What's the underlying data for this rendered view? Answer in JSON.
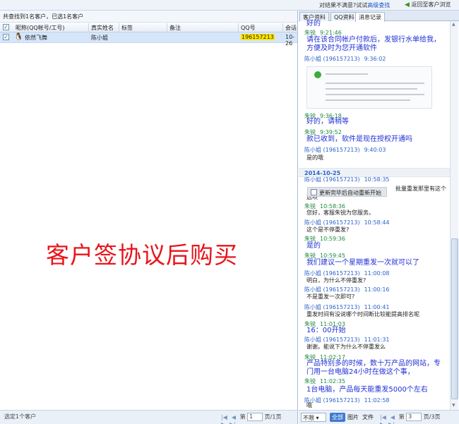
{
  "topbar": {
    "feedback_prefix": "对结果不满意?试试",
    "feedback_link": "高级查找",
    "back_label": "返回至客户浏览"
  },
  "left": {
    "summary": "共查找到1名客户，已选1名客户",
    "columns": [
      "昵称(QQ帐号/工号)",
      "真实姓名",
      "标签",
      "备注",
      "QQ号",
      "会话"
    ],
    "rows": [
      {
        "nickname": "依然飞舞",
        "real_name": "陈小姐",
        "tag": "",
        "note": "",
        "qq": "196157213",
        "session": "10-26"
      }
    ],
    "watermark": "客户签协议后购买",
    "footer": {
      "status": "选定1个客户",
      "page_prefix": "第",
      "page_value": "1",
      "page_suffix": "页/1页"
    }
  },
  "right": {
    "tabs": [
      "客户资料",
      "QQ资料",
      "消息记录"
    ],
    "messages": [
      {
        "type": "text-big",
        "text": "好的"
      },
      {
        "type": "hdr-g",
        "name": "朱锐",
        "time": "9:21:46"
      },
      {
        "type": "text-big",
        "text": "请在该合同帐户付款后，发银行水单给我，"
      },
      {
        "type": "text-big",
        "text": "方便及时为您开通软件"
      },
      {
        "type": "hdr-b",
        "name": "陈小姐 (196157213)",
        "time": "9:36:02"
      },
      {
        "type": "hdr-g",
        "name": "朱锐",
        "time": "9:36:18"
      },
      {
        "type": "text-big",
        "text": "好的，请稍等"
      },
      {
        "type": "hdr-g",
        "name": "朱锐",
        "time": "9:39:52"
      },
      {
        "type": "text-big",
        "text": "款已收到，软件是现在授权开通吗"
      },
      {
        "type": "hdr-b",
        "name": "陈小姐 (196157213)",
        "time": "9:40:03"
      },
      {
        "type": "text-small",
        "text": "是的哦"
      },
      {
        "type": "hdr-b",
        "name": "陈小姐 (196157213)",
        "time": "10:58:35"
      },
      {
        "type": "text-small",
        "text": "批量重发那里有这个"
      },
      {
        "type": "text-small",
        "text": "选项"
      },
      {
        "type": "hdr-g",
        "name": "朱锐",
        "time": "10:58:36"
      },
      {
        "type": "text-small",
        "text": "您好，客服朱锐为您服务。"
      },
      {
        "type": "hdr-b",
        "name": "陈小姐 (196157213)",
        "time": "10:58:44"
      },
      {
        "type": "text-small",
        "text": "这个是不停重发?"
      },
      {
        "type": "hdr-g",
        "name": "朱锐",
        "time": "10:59:36"
      },
      {
        "type": "text-big",
        "text": "是的"
      },
      {
        "type": "hdr-g",
        "name": "朱锐",
        "time": "10:59:45"
      },
      {
        "type": "text-big",
        "text": "我们建议一个星期重发一次就可以了"
      },
      {
        "type": "hdr-b",
        "name": "陈小姐 (196157213)",
        "time": "11:00:08"
      },
      {
        "type": "text-small",
        "text": "明白，为什么不停重发?"
      },
      {
        "type": "hdr-b",
        "name": "陈小姐 (196157213)",
        "time": "11:00:16"
      },
      {
        "type": "text-small",
        "text": "不是重发一次即可?"
      },
      {
        "type": "hdr-b",
        "name": "陈小姐 (196157213)",
        "time": "11:00:41"
      },
      {
        "type": "text-small",
        "text": "重发时间有没说哪个时间断比较能提高排名呢"
      },
      {
        "type": "hdr-g",
        "name": "朱锐",
        "time": "11:01:03"
      },
      {
        "type": "text-big",
        "text": "16：00开始"
      },
      {
        "type": "hdr-b",
        "name": "陈小姐 (196157213)",
        "time": "11:01:31"
      },
      {
        "type": "text-small",
        "text": "谢谢。能说下为什么不停重发么"
      },
      {
        "type": "hdr-g",
        "name": "朱锐",
        "time": "11:02:17"
      },
      {
        "type": "text-big",
        "text": "产品特别多的时候，数十万产品的网站，专"
      },
      {
        "type": "text-big",
        "text": "门用一台电脑24小时在做这个事，"
      },
      {
        "type": "hdr-g",
        "name": "朱锐",
        "time": "11:02:35"
      },
      {
        "type": "text-big",
        "text": "1台电脑，产品每天能重发5000个左右"
      },
      {
        "type": "hdr-b",
        "name": "陈小姐 (196157213)",
        "time": "11:02:58"
      },
      {
        "type": "text-small",
        "text": "哦"
      }
    ],
    "date_divider": "2014-10-25",
    "checkbox_label": "更新完毕后自动重新开始",
    "footer": {
      "dropdown": "不限",
      "tabs": [
        "全部",
        "图片",
        "文件"
      ],
      "page_prefix": "第",
      "page_value": "3",
      "page_suffix": "页/3页"
    }
  }
}
